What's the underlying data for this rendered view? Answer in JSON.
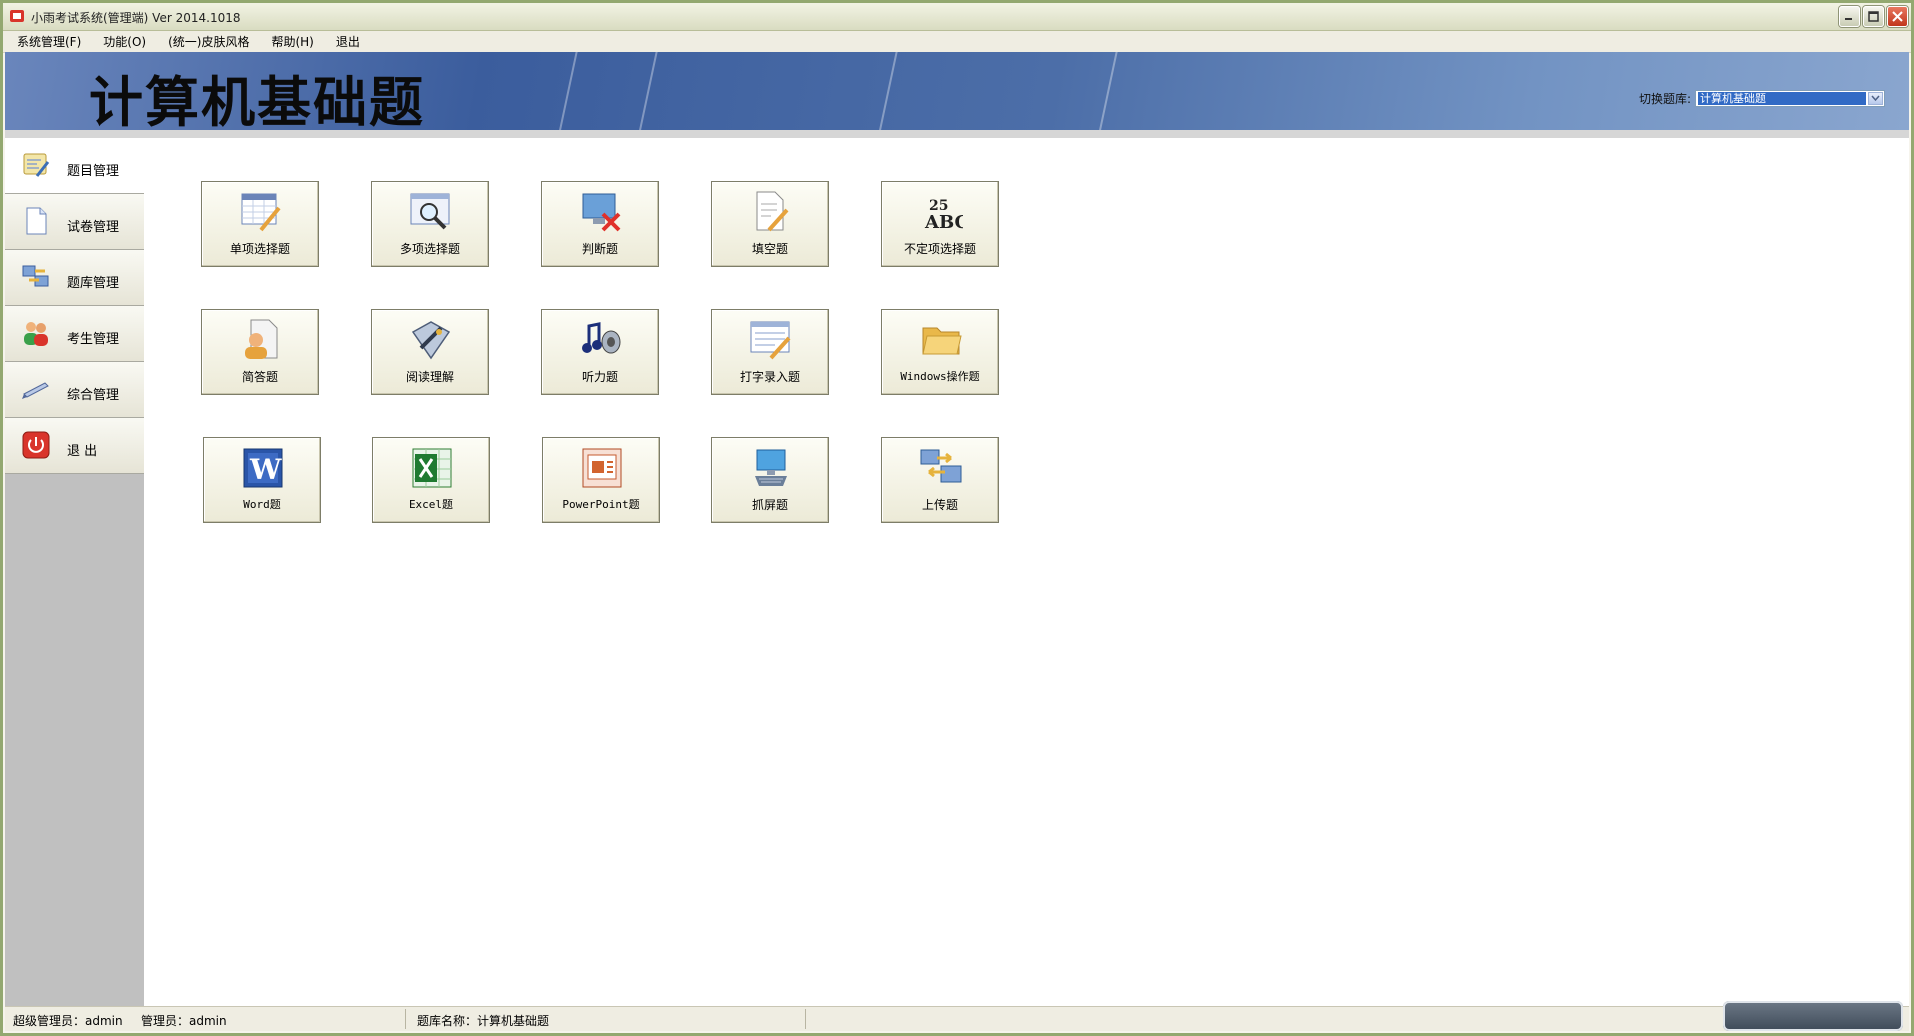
{
  "window": {
    "title": "小雨考试系统(管理端) Ver 2014.1018"
  },
  "menu": [
    "系统管理(F)",
    "功能(O)",
    "(统一)皮肤风格",
    "帮助(H)",
    "退出"
  ],
  "banner": {
    "title": "计算机基础题",
    "switch_label": "切换题库:",
    "switch_value": "计算机基础题"
  },
  "sidebar": {
    "items": [
      {
        "label": "题目管理",
        "icon": "question-edit-icon",
        "active": true
      },
      {
        "label": "试卷管理",
        "icon": "document-icon",
        "active": false
      },
      {
        "label": "题库管理",
        "icon": "database-transfer-icon",
        "active": false
      },
      {
        "label": "考生管理",
        "icon": "users-icon",
        "active": false
      },
      {
        "label": "综合管理",
        "icon": "pen-icon",
        "active": false
      },
      {
        "label": "退  出",
        "icon": "power-icon",
        "active": false
      }
    ]
  },
  "tiles": [
    {
      "label": "单项选择题",
      "icon": "table-pencil-icon"
    },
    {
      "label": "多项选择题",
      "icon": "window-magnifier-icon"
    },
    {
      "label": "判断题",
      "icon": "monitor-x-icon"
    },
    {
      "label": "填空题",
      "icon": "page-pencil-icon"
    },
    {
      "label": "不定项选择题",
      "icon": "abc-icon"
    },
    {
      "label": "简答题",
      "icon": "person-document-icon"
    },
    {
      "label": "阅读理解",
      "icon": "book-pen-icon"
    },
    {
      "label": "听力题",
      "icon": "music-speaker-icon"
    },
    {
      "label": "打字录入题",
      "icon": "form-pencil-icon"
    },
    {
      "label": "Windows操作题",
      "icon": "folder-icon"
    },
    {
      "label": "Word题",
      "icon": "word-icon"
    },
    {
      "label": "Excel题",
      "icon": "excel-icon"
    },
    {
      "label": "PowerPoint题",
      "icon": "powerpoint-icon"
    },
    {
      "label": "抓屏题",
      "icon": "screen-capture-icon"
    },
    {
      "label": "上传题",
      "icon": "upload-icon"
    }
  ],
  "status": {
    "super_admin": "超级管理员：admin",
    "admin": "管理员：admin",
    "bank": "题库名称：计算机基础题"
  },
  "colors": {
    "banner": "#3b5d9d",
    "sidebar": "#c0c0c0",
    "select_highlight": "#316ac5",
    "close_button": "#c1361c"
  }
}
